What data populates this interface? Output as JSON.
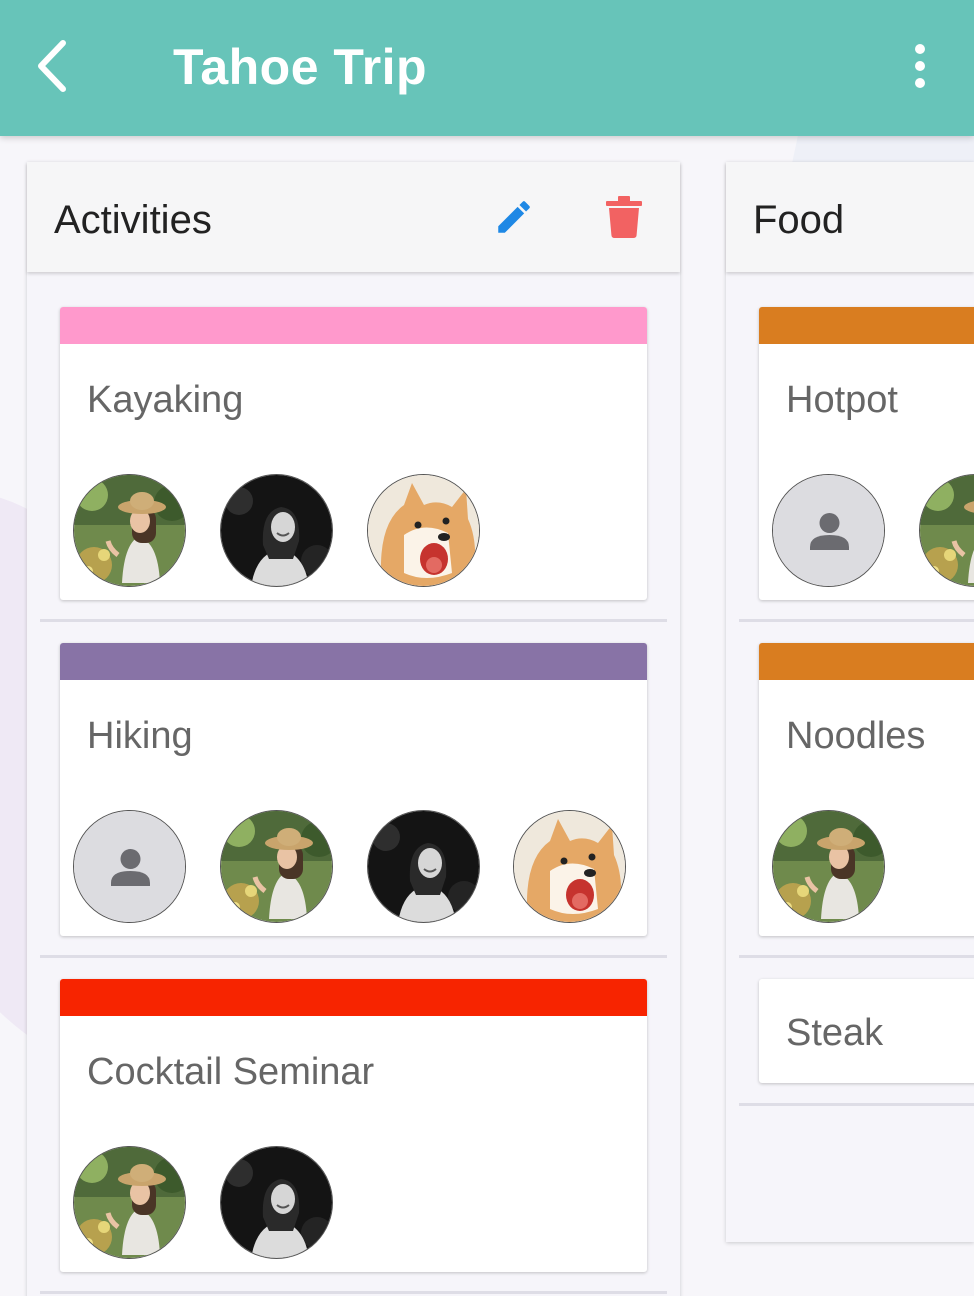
{
  "app_bar": {
    "title": "Tahoe Trip",
    "back_icon": "chevron-left-icon",
    "more_icon": "more-vert-icon",
    "color": "#67c4b9"
  },
  "columns": [
    {
      "title": "Activities",
      "edit_icon": "pencil-icon",
      "delete_icon": "trash-icon",
      "cards": [
        {
          "title": "Kayaking",
          "color": "#ff99cc",
          "members": [
            "girl-hat-photo",
            "girl-bw-photo",
            "shiba-photo"
          ]
        },
        {
          "title": "Hiking",
          "color": "#8873a6",
          "members": [
            "default-user-avatar",
            "girl-hat-photo",
            "girl-bw-photo",
            "shiba-photo"
          ]
        },
        {
          "title": "Cocktail Seminar",
          "color": "#f72400",
          "members": [
            "girl-hat-photo",
            "girl-bw-photo"
          ]
        }
      ]
    },
    {
      "title": "Food",
      "cards": [
        {
          "title": "Hotpot",
          "color": "#d97d20",
          "members": [
            "default-user-avatar",
            "girl-hat-photo"
          ]
        },
        {
          "title": "Noodles",
          "color": "#d97d20",
          "members": [
            "girl-hat-photo"
          ]
        },
        {
          "title": "Steak",
          "color": null,
          "members": []
        }
      ]
    }
  ],
  "colors": {
    "edit": "#1e88e5",
    "delete": "#f26262"
  }
}
